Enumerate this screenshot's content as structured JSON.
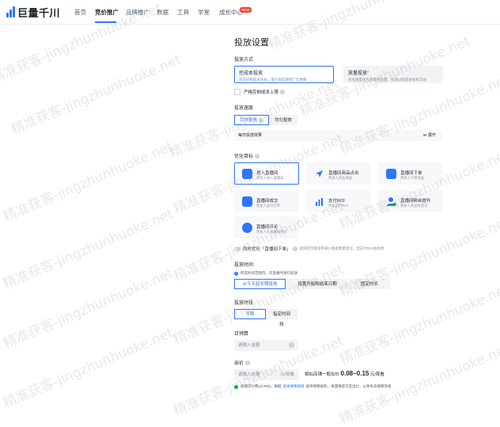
{
  "nav": {
    "logo": "巨量千川",
    "items": [
      "首页",
      "竞价推广",
      "品牌推广",
      "数据",
      "工具",
      "学堂",
      "成长中心"
    ],
    "active": "竞价推广",
    "new_badge": "NEW"
  },
  "page_title": "投放设置",
  "bid_mode": {
    "label": "投放方式",
    "options": [
      {
        "title": "控成本投放",
        "desc": "优先控制成本达标，最大限度使用广告预算"
      },
      {
        "title": "放量投放",
        "desc": "优先跑量优先获取更多量，投放过程成本会有浮动"
      }
    ],
    "strict_cost_label": "严格控制成本上限"
  },
  "speed": {
    "label": "投放速度",
    "options": [
      "尽快投放",
      "均匀投放"
    ]
  },
  "budget_effect": {
    "label": "每日投放效果",
    "expand": "展开"
  },
  "goal": {
    "label": "优化目标",
    "options": [
      {
        "title": "进入直播间",
        "desc": "更多人进入直播间",
        "color": "#2e74ff"
      },
      {
        "title": "直播间商品点击",
        "desc": "更多人点击商品",
        "color": "#2e74ff"
      },
      {
        "title": "直播间下单",
        "desc": "更多人下单商品",
        "color": "#2e74ff"
      },
      {
        "title": "直播间成交",
        "desc": "更多人支付订单",
        "color": "#2e74ff"
      },
      {
        "title": "支付ROI",
        "desc": "优化支付ROI",
        "color": "#2e74ff"
      },
      {
        "title": "直播间粉丝提升",
        "desc": "更多人关注抖音号",
        "color": "#2e74ff"
      },
      {
        "title": "直播间评论",
        "desc": "更多人在直播间评论",
        "color": "#2e74ff"
      }
    ]
  },
  "deep_opt": {
    "label": "同时优化「直播间下单」",
    "hint": "选择后可能会带来小幅度数量变化，但支付ROI会改善"
  },
  "schedule": {
    "label": "投放时间",
    "tip": "所选时间范围内，仅直播时进行投放",
    "options": [
      "从今天起长期投放",
      "设置开始和结束日期",
      "固定时长"
    ]
  },
  "period": {
    "label": "投放时段",
    "options": [
      "不限",
      "指定时间段"
    ]
  },
  "daily_budget": {
    "label": "日预算",
    "placeholder": "请输入金额"
  },
  "bid": {
    "label": "出价",
    "placeholder": "请输入价格",
    "unit": "元/观看",
    "ref_prefix": "相似店铺一般出价",
    "ref_value": "0.08~0.15",
    "ref_unit": "元/观看",
    "guard_prefix": "按播次付费(oCPM)，根据",
    "guard_link": "成本保障规则",
    "guard_suffix": "提供保障福利，请谨慎提交后出价，以免失去保障资格"
  },
  "watermark": "精准获客-jingzhunhuoke.net",
  "colors": {
    "accent": "#2e74ff",
    "badge": "#f53f3f"
  }
}
